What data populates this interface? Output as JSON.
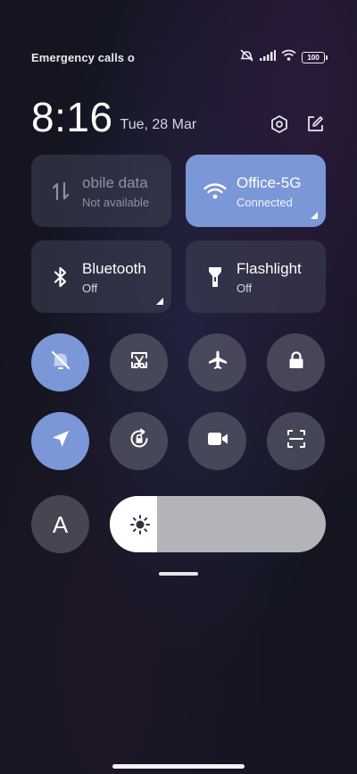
{
  "status": {
    "carrier_text": "Emergency calls o",
    "battery": "100"
  },
  "header": {
    "time": "8:16",
    "date": "Tue, 28 Mar"
  },
  "tiles": {
    "mobile_data": {
      "title": "obile data",
      "subtitle": "Not available",
      "state": "disabled"
    },
    "wifi": {
      "title": "Office-5G",
      "subtitle": "Connected",
      "state": "on"
    },
    "bluetooth": {
      "title": "Bluetooth",
      "subtitle": "Off",
      "state": "off"
    },
    "flashlight": {
      "title": "Flashlight",
      "subtitle": "Off",
      "state": "off"
    }
  },
  "toggles": {
    "row1": [
      "mute-icon",
      "screenshot-icon",
      "airplane-icon",
      "lock-icon"
    ],
    "row2": [
      "location-icon",
      "rotation-lock-icon",
      "video-camera-icon",
      "scan-icon"
    ]
  },
  "auto_brightness": {
    "label": "A"
  },
  "brightness": {
    "level": 0.22
  },
  "colors": {
    "accent": "#7b97d7",
    "tile": "#404456",
    "round": "#545664"
  }
}
